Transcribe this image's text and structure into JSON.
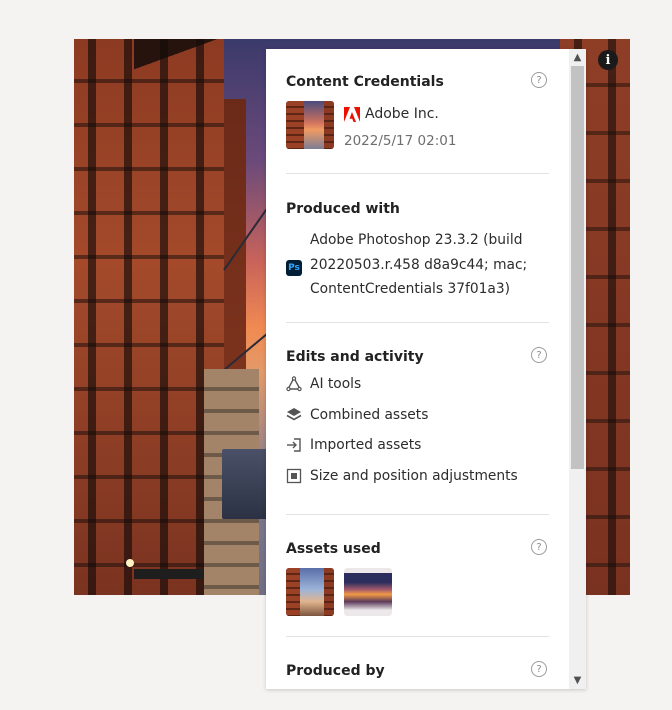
{
  "info_button_glyph": "i",
  "content_credentials": {
    "title": "Content Credentials",
    "issuer": "Adobe Inc.",
    "date": "2022/5/17 02:01"
  },
  "produced_with": {
    "title": "Produced with",
    "app_icon_label": "Ps",
    "app_text": "Adobe Photoshop 23.3.2 (build 20220503.r.458 d8a9c44; mac; ContentCredentials 37f01a3)"
  },
  "edits": {
    "title": "Edits and activity",
    "items": [
      {
        "label": "AI tools",
        "icon": "ai-tools-icon"
      },
      {
        "label": "Combined assets",
        "icon": "layers-icon"
      },
      {
        "label": "Imported assets",
        "icon": "import-icon"
      },
      {
        "label": "Size and position adjustments",
        "icon": "resize-icon"
      }
    ]
  },
  "assets_used": {
    "title": "Assets used",
    "thumbnails": [
      "city-bridge-thumbnail",
      "sunset-thumbnail"
    ]
  },
  "produced_by": {
    "title": "Produced by"
  },
  "help_glyph": "?",
  "scroll": {
    "up_glyph": "▲",
    "down_glyph": "▼"
  }
}
